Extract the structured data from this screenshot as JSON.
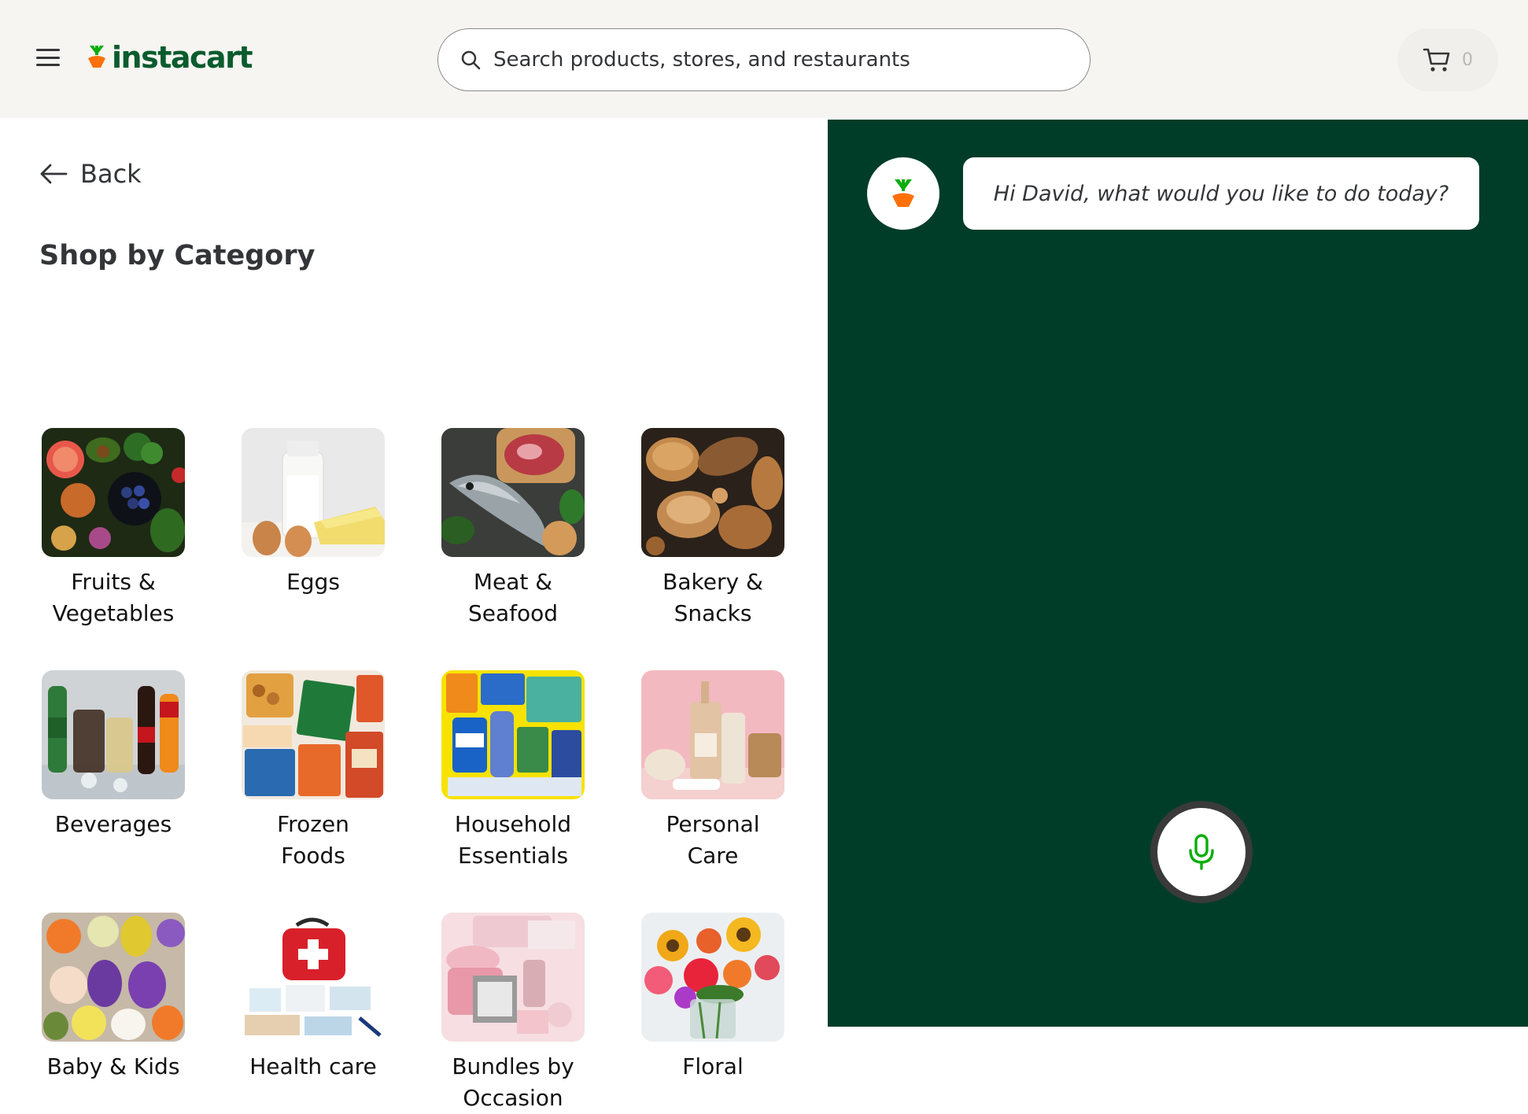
{
  "header": {
    "logo_text": "instacart",
    "search_placeholder": "Search products, stores, and restaurants",
    "cart_count": "0"
  },
  "left": {
    "back_label": "Back",
    "section_title": "Shop by Category",
    "categories": [
      {
        "label": "Fruits & Vegetables",
        "icon": "produce-image"
      },
      {
        "label": "Eggs",
        "icon": "eggs-image"
      },
      {
        "label": "Meat & Seafood",
        "icon": "meat-seafood-image"
      },
      {
        "label": "Bakery & Snacks",
        "icon": "bakery-image"
      },
      {
        "label": "Beverages",
        "icon": "beverages-image"
      },
      {
        "label": "Frozen Foods",
        "icon": "frozen-image"
      },
      {
        "label": "Household Essentials",
        "icon": "household-image"
      },
      {
        "label": "Personal Care",
        "icon": "personal-care-image"
      },
      {
        "label": "Baby & Kids",
        "icon": "baby-kids-image"
      },
      {
        "label": "Health care",
        "icon": "health-care-image"
      },
      {
        "label": "Bundles by Occasion",
        "icon": "bundles-image"
      },
      {
        "label": "Floral",
        "icon": "floral-image"
      }
    ]
  },
  "assistant": {
    "greeting": "Hi David, what would you like to do today?"
  },
  "colors": {
    "brand_green": "#0a5b2e",
    "carrot_orange": "#ff7009",
    "panel_green": "#003d29",
    "header_bg": "#f6f5f1"
  }
}
